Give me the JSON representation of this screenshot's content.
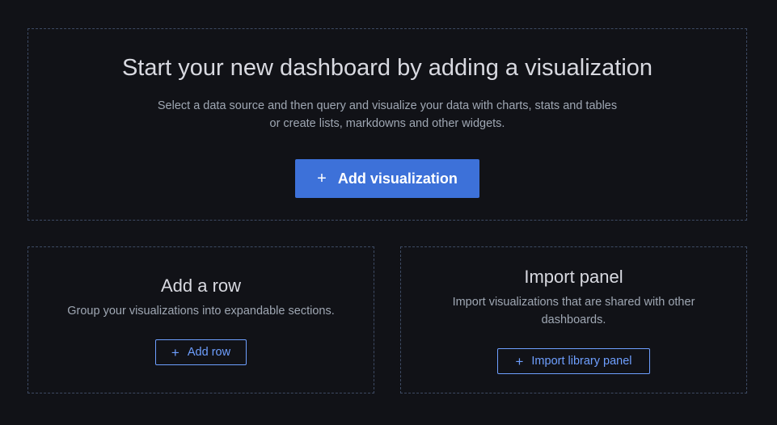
{
  "main": {
    "title": "Start your new dashboard by adding a visualization",
    "description_line1": "Select a data source and then query and visualize your data with charts, stats and tables",
    "description_line2": "or create lists, markdowns and other widgets.",
    "button_label": "Add visualization",
    "button_icon": "plus-icon"
  },
  "add_row": {
    "title": "Add a row",
    "description": "Group your visualizations into expandable sections.",
    "button_label": "Add row",
    "button_icon": "plus-icon"
  },
  "import_panel": {
    "title": "Import panel",
    "description": "Import visualizations that are shared with other dashboards.",
    "button_label": "Import library panel",
    "button_icon": "plus-icon"
  },
  "colors": {
    "background": "#111217",
    "primary": "#3d71d9",
    "accent_text": "#6e9fff",
    "border": "#3d4a63"
  }
}
